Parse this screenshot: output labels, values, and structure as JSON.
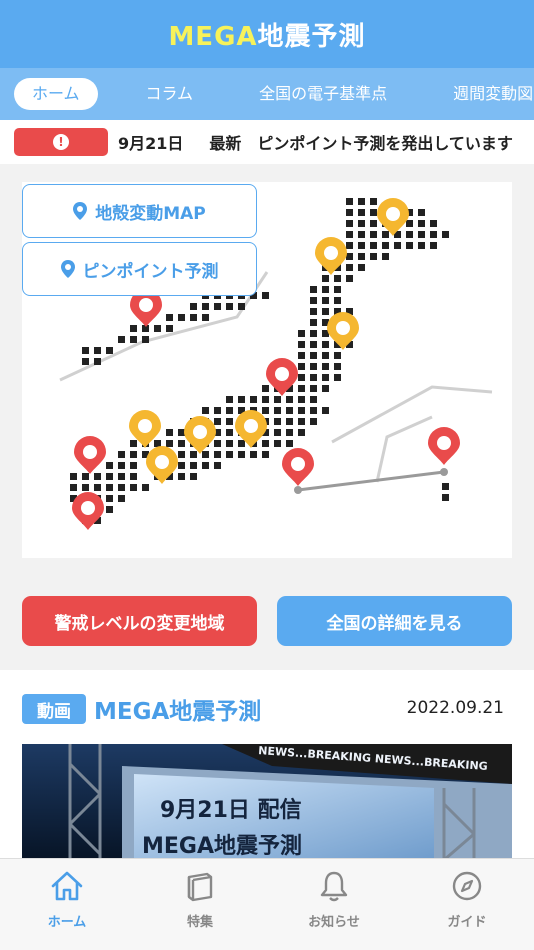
{
  "header": {
    "title_accent": "MEGA",
    "title_rest": "地震予測"
  },
  "tabs": [
    {
      "label": "ホーム",
      "active": true
    },
    {
      "label": "コラム"
    },
    {
      "label": "全国の電子基準点"
    },
    {
      "label": "週間変動図 (H)"
    }
  ],
  "ticker": {
    "date": "9月21日",
    "text": "最新　ピンポイント予測を発出しています"
  },
  "map": {
    "crustal_button": "地殻変動MAP",
    "pinpoint_button": "ピンポイント予測",
    "pin_levels": [
      "yellow",
      "yellow",
      "red",
      "yellow",
      "red",
      "yellow",
      "yellow",
      "yellow",
      "red",
      "red",
      "red",
      "yellow",
      "red"
    ],
    "colors": {
      "pin_yellow": "#f5b730",
      "pin_red": "#e94b4b",
      "land": "#222222"
    }
  },
  "actions": {
    "warning_regions": "警戒レベルの変更地域",
    "national_details": "全国の詳細を見る"
  },
  "video": {
    "badge": "動画",
    "title": "MEGA地震予測",
    "date": "2022.09.21",
    "thumb_banner": "NEWS...BREAKING NEWS...BREAKING",
    "thumb_line1": "9月21日 配信",
    "thumb_line2": "MEGA地震予測"
  },
  "nav": [
    {
      "label": "ホーム",
      "icon": "home-icon",
      "active": true
    },
    {
      "label": "特集",
      "icon": "book-icon"
    },
    {
      "label": "お知らせ",
      "icon": "bell-icon"
    },
    {
      "label": "ガイド",
      "icon": "compass-icon"
    }
  ],
  "colors": {
    "primary": "#5aaaf0",
    "tab_bar": "#7dbcf3",
    "alert": "#e94b4b",
    "title_accent": "#f7f25a"
  }
}
